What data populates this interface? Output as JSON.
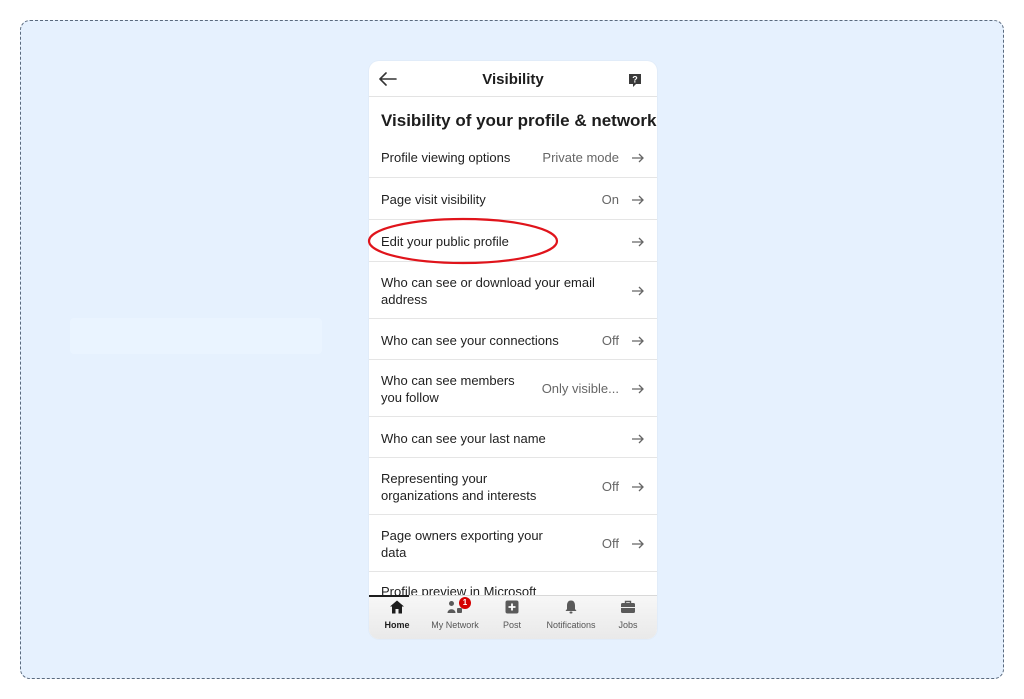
{
  "header": {
    "title": "Visibility"
  },
  "section": {
    "title": "Visibility of your profile & network"
  },
  "rows": [
    {
      "label": "Profile viewing options",
      "value": "Private mode"
    },
    {
      "label": "Page visit visibility",
      "value": "On"
    },
    {
      "label": "Edit your public profile",
      "value": ""
    },
    {
      "label": "Who can see or download your email address",
      "value": ""
    },
    {
      "label": "Who can see your connections",
      "value": "Off"
    },
    {
      "label": "Who can see members you follow",
      "value": "Only visible..."
    },
    {
      "label": "Who can see your last name",
      "value": ""
    },
    {
      "label": "Representing your organizations and interests",
      "value": "Off"
    },
    {
      "label": "Page owners exporting your data",
      "value": "Off"
    }
  ],
  "partial_row": {
    "label": "Profile preview in Microsoft"
  },
  "tabs": [
    {
      "label": "Home",
      "icon": "home-icon",
      "active": true
    },
    {
      "label": "My Network",
      "icon": "network-icon",
      "badge": "1"
    },
    {
      "label": "Post",
      "icon": "post-icon"
    },
    {
      "label": "Notifications",
      "icon": "bell-icon"
    },
    {
      "label": "Jobs",
      "icon": "briefcase-icon"
    }
  ],
  "colors": {
    "highlight": "#e0141b",
    "badge": "#d40000",
    "background": "#e6f1fe"
  }
}
